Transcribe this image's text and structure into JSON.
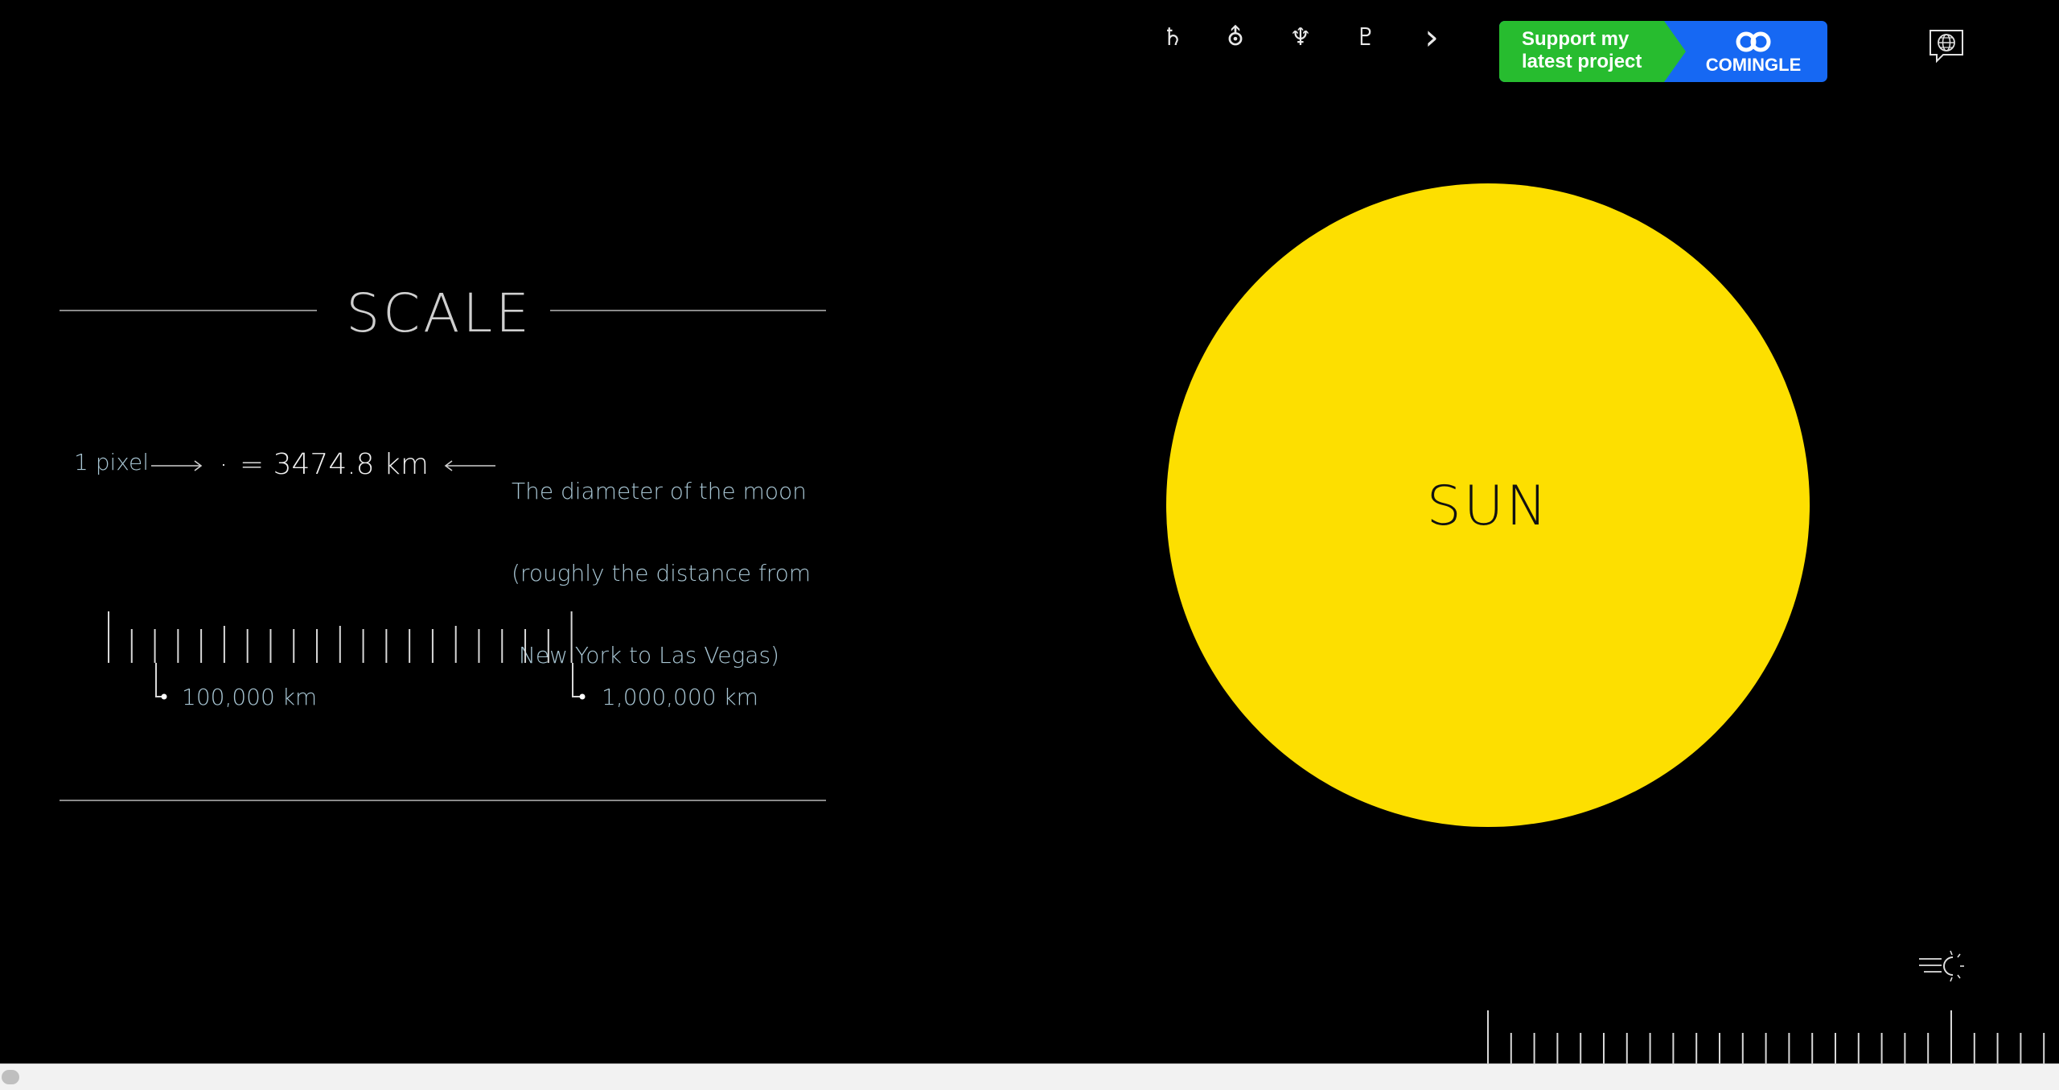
{
  "nav": {
    "icons": [
      {
        "name": "saturn-icon",
        "glyph": "♄"
      },
      {
        "name": "uranus-icon",
        "glyph": "⛢"
      },
      {
        "name": "neptune-icon",
        "glyph": "♆"
      },
      {
        "name": "pluto-icon",
        "glyph": "♇"
      },
      {
        "name": "next-arrow-icon",
        "glyph": "›"
      }
    ]
  },
  "banner": {
    "text": "Support my latest project",
    "brand": "COMINGLE",
    "colors": {
      "green": "#27bc2f",
      "blue": "#1668f3"
    }
  },
  "language_icon": "globe-speech-bubble-icon",
  "scale": {
    "title": "SCALE",
    "pixel_label": "1 pixel",
    "equals_value": "= 3474.8 km",
    "explanation_lines": [
      "The diameter of the moon",
      "(roughly the distance from",
      " New York to Las Vegas)"
    ],
    "ruler_labels": [
      "100,000 km",
      "1,000,000 km"
    ]
  },
  "sun": {
    "label": "SUN",
    "color": "#fddf00"
  },
  "speed_icon": "light-speed-icon",
  "colors": {
    "background": "#000000",
    "label_blue": "#a8c6d4"
  }
}
